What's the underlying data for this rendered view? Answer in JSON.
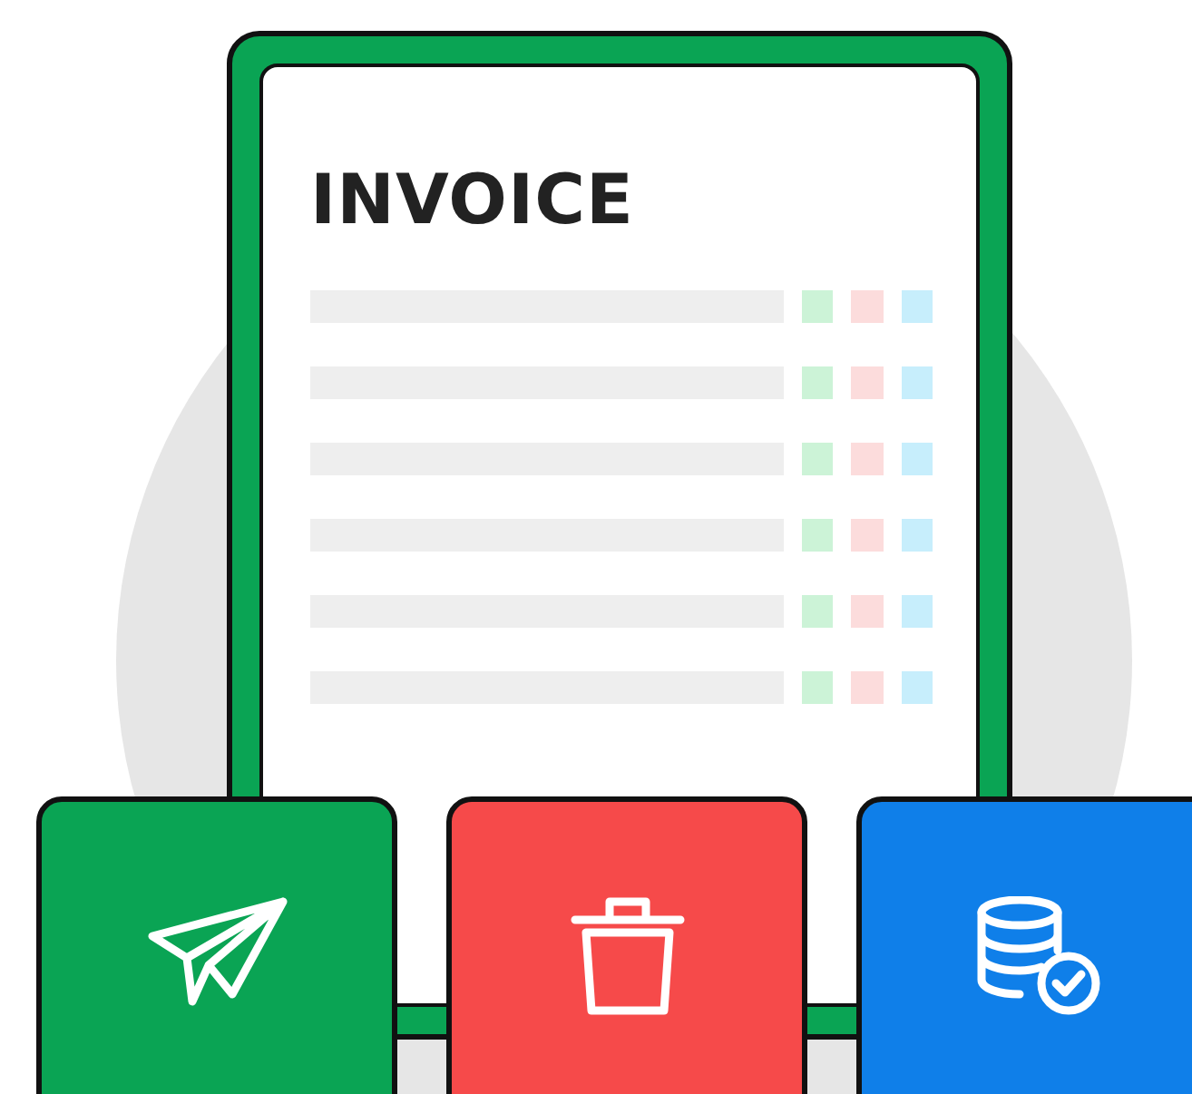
{
  "document": {
    "title": "INVOICE"
  },
  "actions": [
    {
      "kind": "send",
      "color": "#0aa454"
    },
    {
      "kind": "delete",
      "color": "#f64a4a"
    },
    {
      "kind": "database",
      "color": "#0f7fe9"
    }
  ]
}
